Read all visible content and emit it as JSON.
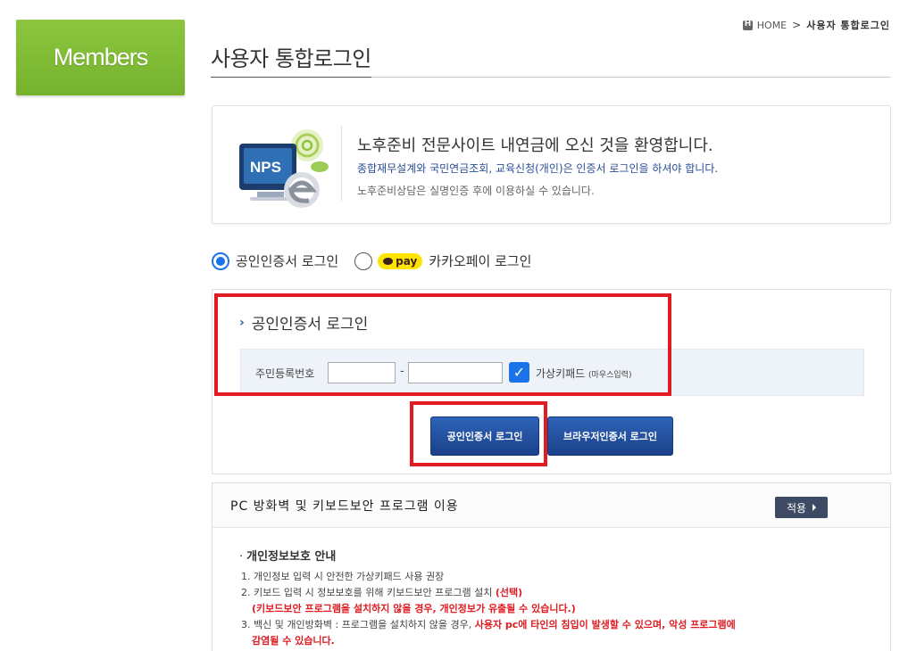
{
  "sidebar": {
    "members_label": "Members"
  },
  "breadcrumb": {
    "home": "HOME",
    "separator": ">",
    "current": "사용자 통합로그인"
  },
  "page": {
    "title": "사용자 통합로그인"
  },
  "welcome": {
    "logo_text": "NPS",
    "heading": "노후준비 전문사이트 내연금에 오신 것을 환영합니다.",
    "line2": "종합재무설계와 국민연금조회, 교육신청(개인)은 인증서 로그인을 하셔야 합니다.",
    "line3": "노후준비상담은 실명인증 후에 이용하실 수 있습니다."
  },
  "login_options": {
    "option1": {
      "label": "공인인증서 로그인",
      "selected": true
    },
    "option2": {
      "badge": "pay",
      "label": "카카오페이 로그인",
      "selected": false
    }
  },
  "cert_login": {
    "title": "공인인증서 로그인",
    "rrn_label": "주민등록번호",
    "rrn_part1": "",
    "rrn_part2": "",
    "dash": "-",
    "virtual_keypad_label": "가상키패드",
    "virtual_keypad_sub": "(마우스입력)",
    "virtual_keypad_checked": true
  },
  "buttons": {
    "cert_login": "공인인증서 로그인",
    "browser_cert_login": "브라우저인증서 로그인"
  },
  "security": {
    "title": "PC 방화벽 및 키보드보안 프로그램 이용",
    "apply_label": "적용",
    "privacy_heading": "개인정보보호 안내",
    "line1": "1. 개인정보 입력 시 안전한 가상키패드 사용 권장",
    "line2_prefix": "2. 키보드 입력 시 정보보호를 위해 키보드보안 프로그램 설치",
    "line2_red": "(선택)",
    "line2_sub": "(키보드보안 프로그램을 설치하지 않을 경우, 개인정보가 유출될 수 있습니다.)",
    "line3_prefix": "3. 백신 및 개인방화벽 : 프로그램을 설치하지 않을 경우,",
    "line3_red": "사용자 pc에 타인의 침입이 발생할 수 있으며, 악성 프로그램에",
    "line3_red2": "감염될 수 있습니다."
  },
  "colors": {
    "accent_green": "#8cc63f",
    "button_blue": "#1f4d9c",
    "highlight_red": "#e11b22",
    "link_blue": "#2a4e9a"
  }
}
